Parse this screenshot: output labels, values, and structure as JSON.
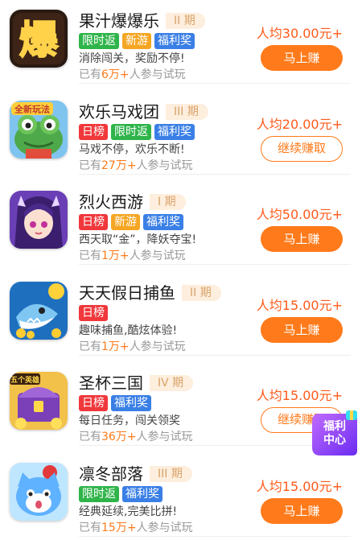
{
  "colors": {
    "accent": "#ff7a1a",
    "tag_red": "#f0383c",
    "tag_green": "#2fb44a",
    "tag_orange": "#f5a623",
    "tag_blue": "#3a7fe6",
    "period_bg": "#fdeedd"
  },
  "float_badge": {
    "line1": "福利",
    "line2": "中心"
  },
  "games": [
    {
      "name": "果汁爆爆乐",
      "period": "II 期",
      "tags": [
        {
          "text": "限时返",
          "color": "green"
        },
        {
          "text": "新游",
          "color": "orange"
        },
        {
          "text": "福利奖",
          "color": "blue"
        }
      ],
      "desc": "消除闯关，奖励不停!",
      "count_prefix": "已有",
      "count_num": "6万+",
      "count_suffix": "人参与试玩",
      "reward": "人均30.00元+",
      "button": "马上赚",
      "button_style": "primary",
      "icon": "baobao-icon"
    },
    {
      "name": "欢乐马戏团",
      "period": "III 期",
      "tags": [
        {
          "text": "日榜",
          "color": "red"
        },
        {
          "text": "限时返",
          "color": "green"
        },
        {
          "text": "福利奖",
          "color": "blue"
        }
      ],
      "desc": "马戏不停，欢乐不断!",
      "count_prefix": "已有",
      "count_num": "27万+",
      "count_suffix": "人参与试玩",
      "reward": "人均20.00元+",
      "button": "继续赚取",
      "button_style": "outline",
      "icon": "frog-icon",
      "icon_badge": "全新玩法"
    },
    {
      "name": "烈火西游",
      "period": "I 期",
      "tags": [
        {
          "text": "日榜",
          "color": "red"
        },
        {
          "text": "新游",
          "color": "orange"
        },
        {
          "text": "福利奖",
          "color": "blue"
        }
      ],
      "desc": "西天取“金”，降妖夺宝!",
      "count_prefix": "已有",
      "count_num": "1万+",
      "count_suffix": "人参与试玩",
      "reward": "人均50.00元+",
      "button": "马上赚",
      "button_style": "primary",
      "icon": "heroine-icon"
    },
    {
      "name": "天天假日捕鱼",
      "period": "II 期",
      "tags": [
        {
          "text": "日榜",
          "color": "red"
        }
      ],
      "desc": "趣味捕鱼,酷炫体验!",
      "count_prefix": "已有",
      "count_num": "1万+",
      "count_suffix": "人参与试玩",
      "reward": "人均15.00元+",
      "button": "马上赚",
      "button_style": "primary",
      "icon": "shark-icon"
    },
    {
      "name": "圣杯三国",
      "period": "IV 期",
      "tags": [
        {
          "text": "日榜",
          "color": "red"
        },
        {
          "text": "福利奖",
          "color": "blue"
        }
      ],
      "desc": "每日任务，闯关领奖",
      "count_prefix": "已有",
      "count_num": "36万+",
      "count_suffix": "人参与试玩",
      "reward": "人均15.00元+",
      "button": "继续赚取",
      "button_style": "outline",
      "icon": "treasure-chest-icon",
      "icon_badge": "五个英雄"
    },
    {
      "name": "凛冬部落",
      "period": "III 期",
      "tags": [
        {
          "text": "限时返",
          "color": "green"
        },
        {
          "text": "福利奖",
          "color": "blue"
        }
      ],
      "desc": "经典延续,完美比拼!",
      "count_prefix": "已有",
      "count_num": "15万+",
      "count_suffix": "人参与试玩",
      "reward": "人均15.00元+",
      "button": "马上赚",
      "button_style": "primary",
      "icon": "cat-icon"
    }
  ]
}
